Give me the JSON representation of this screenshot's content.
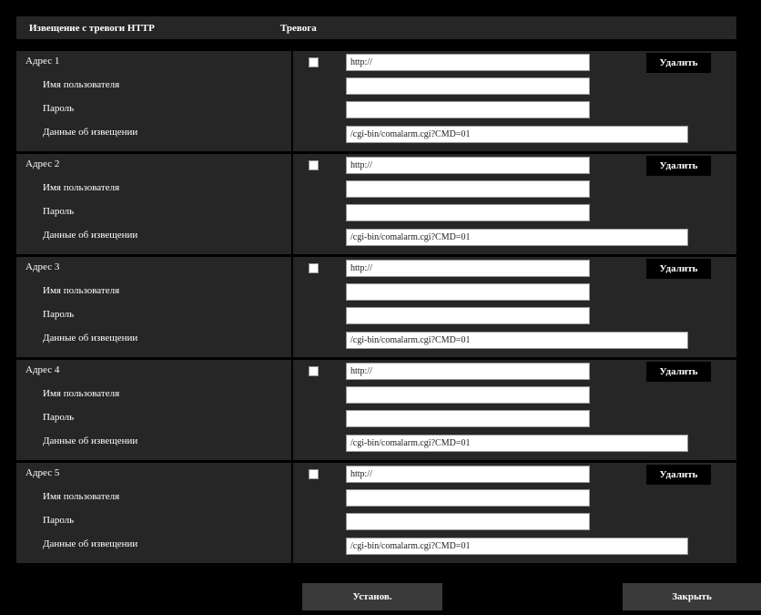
{
  "header": {
    "col1": "Извещение с тревоги HTTP",
    "col2": "Тревога"
  },
  "labels": {
    "username": "Имя пользователя",
    "password": "Пароль",
    "notification_data": "Данные об извещении"
  },
  "delete_label": "Удалить",
  "rows": [
    {
      "address_label": "Адрес 1",
      "checked": false,
      "url": "http://",
      "username": "",
      "password": "",
      "data": "/cgi-bin/comalarm.cgi?CMD=01"
    },
    {
      "address_label": "Адрес 2",
      "checked": false,
      "url": "http://",
      "username": "",
      "password": "",
      "data": "/cgi-bin/comalarm.cgi?CMD=01"
    },
    {
      "address_label": "Адрес 3",
      "checked": false,
      "url": "http://",
      "username": "",
      "password": "",
      "data": "/cgi-bin/comalarm.cgi?CMD=01"
    },
    {
      "address_label": "Адрес 4",
      "checked": false,
      "url": "http://",
      "username": "",
      "password": "",
      "data": "/cgi-bin/comalarm.cgi?CMD=01"
    },
    {
      "address_label": "Адрес 5",
      "checked": false,
      "url": "http://",
      "username": "",
      "password": "",
      "data": "/cgi-bin/comalarm.cgi?CMD=01"
    }
  ],
  "footer": {
    "set_label": "Установ.",
    "close_label": "Закрыть"
  }
}
